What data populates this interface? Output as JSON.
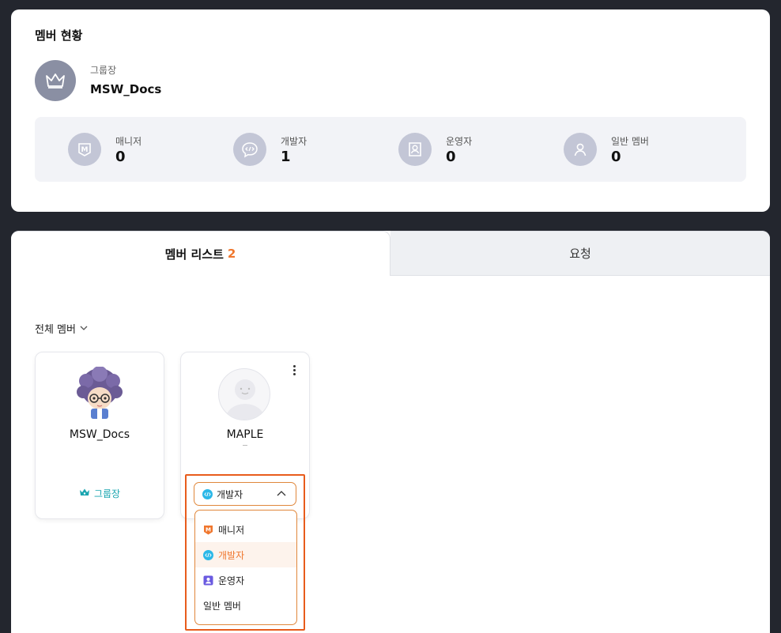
{
  "status": {
    "title": "멤버 현황",
    "leader": {
      "role": "그룹장",
      "name": "MSW_Docs"
    },
    "stats": [
      {
        "icon": "manager-icon",
        "label": "매니저",
        "value": "0"
      },
      {
        "icon": "developer-icon",
        "label": "개발자",
        "value": "1"
      },
      {
        "icon": "operator-icon",
        "label": "운영자",
        "value": "0"
      },
      {
        "icon": "member-icon",
        "label": "일반 멤버",
        "value": "0"
      }
    ]
  },
  "tabs": {
    "members": {
      "label": "멤버 리스트",
      "count": "2"
    },
    "requests": {
      "label": "요청"
    }
  },
  "filter": {
    "label": "전체 멤버"
  },
  "members": [
    {
      "name": "MSW_Docs",
      "role": "그룹장"
    },
    {
      "name": "MAPLE",
      "detail": "-"
    }
  ],
  "role_select": {
    "value": "개발자",
    "options": [
      "매니저",
      "개발자",
      "운영자",
      "일반 멤버"
    ]
  },
  "colors": {
    "accent": "#f0772e",
    "highlight": "#e85c1c",
    "leader_role": "#1aa5b0",
    "developer": "#2bb8e8",
    "manager": "#f0772e",
    "operator": "#6a5ae0"
  }
}
